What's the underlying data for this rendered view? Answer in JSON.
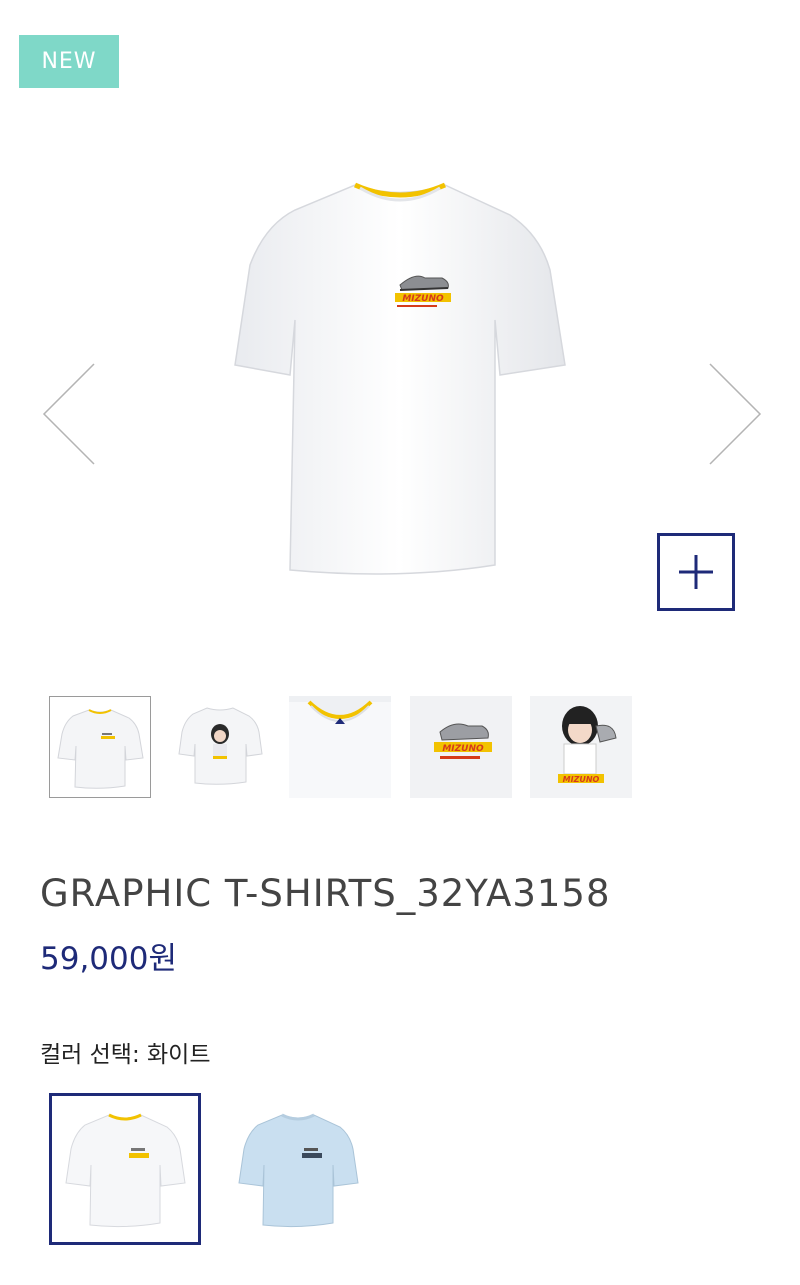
{
  "badge": {
    "label": "NEW"
  },
  "product": {
    "title": "GRAPHIC T-SHIRTS_32YA3158",
    "price": "59,000원",
    "color_label": "컬러 선택",
    "color_separator": ": ",
    "selected_color": "화이트"
  },
  "gallery": {
    "prev_icon": "chevron-left-icon",
    "next_icon": "chevron-right-icon",
    "zoom_icon": "plus-icon",
    "thumbnail_count": 5,
    "active_thumbnail": 1
  },
  "swatches": [
    {
      "name": "white",
      "color": "#ffffff",
      "selected": true
    },
    {
      "name": "sky-blue",
      "color": "#c9dff0",
      "selected": false
    }
  ],
  "colors": {
    "accent": "#1e2a78",
    "badge": "#7fd8c8",
    "logo_yellow": "#f2c200",
    "logo_red": "#d63b1a"
  }
}
